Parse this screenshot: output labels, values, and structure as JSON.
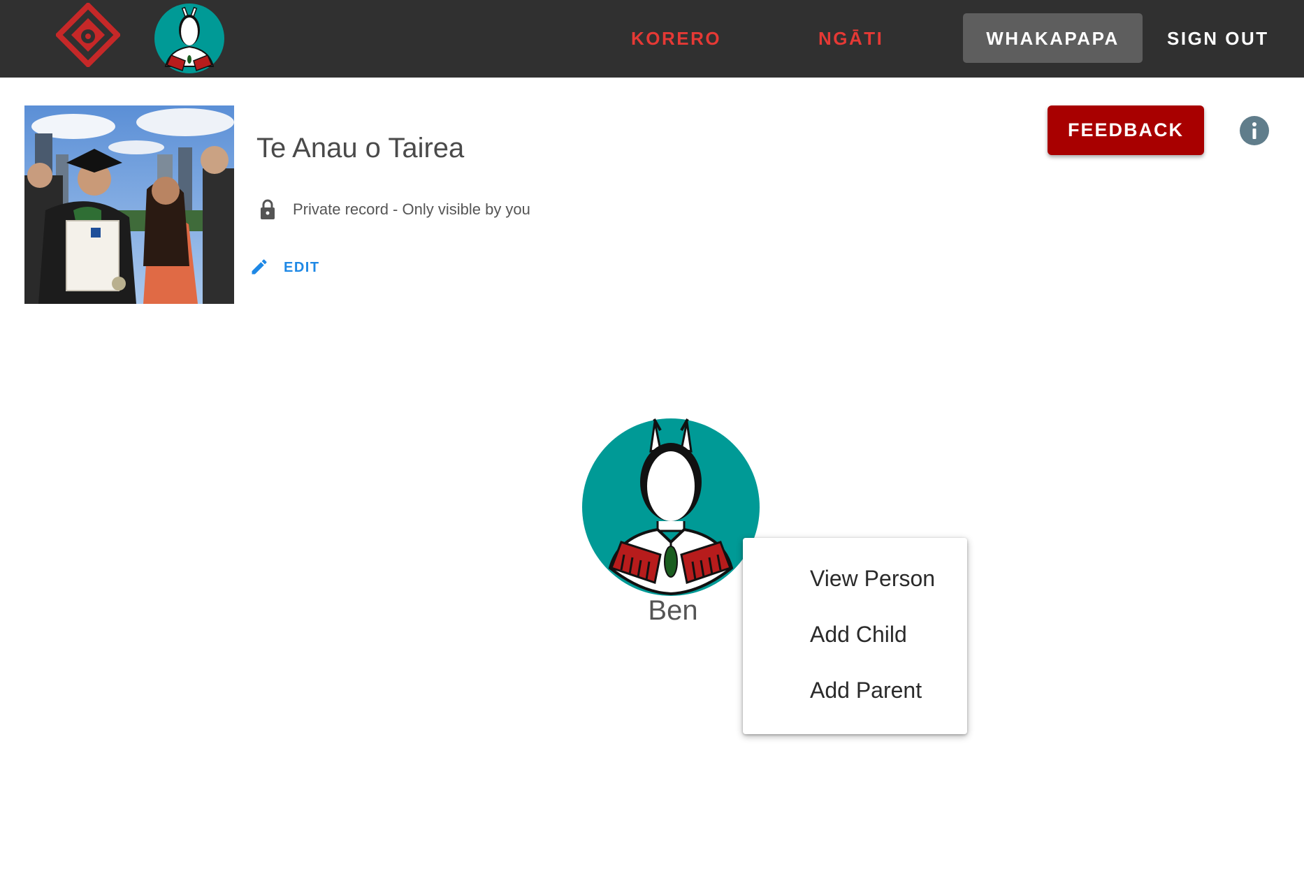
{
  "header": {
    "logo_icon": "koru-diamond-logo-icon",
    "avatar_icon": "maori-warrior-avatar-icon",
    "nav": {
      "korero": "KORERO",
      "ngati": "NGĀTI",
      "whakapapa": "WHAKAPAPA",
      "sign_out": "SIGN OUT"
    },
    "active_tab": "WHAKAPAPA",
    "colors": {
      "bar": "#303030",
      "nav_red": "#e53935",
      "active_bg": "#5e5e5e"
    }
  },
  "record": {
    "title": "Te Anau o Tairea",
    "privacy_icon": "lock-icon",
    "privacy_text": "Private record - Only visible by you",
    "edit_icon": "pencil-icon",
    "edit_label": "EDIT",
    "photo": "group-graduation-photo"
  },
  "actions": {
    "feedback_label": "FEEDBACK",
    "feedback_color": "#a80000",
    "info_icon": "info-icon"
  },
  "tree": {
    "node": {
      "name": "Ben",
      "avatar_icon": "maori-warrior-avatar-icon",
      "avatar_bg": "#009a96"
    }
  },
  "context_menu": {
    "items": [
      "View Person",
      "Add Child",
      "Add Parent"
    ]
  }
}
